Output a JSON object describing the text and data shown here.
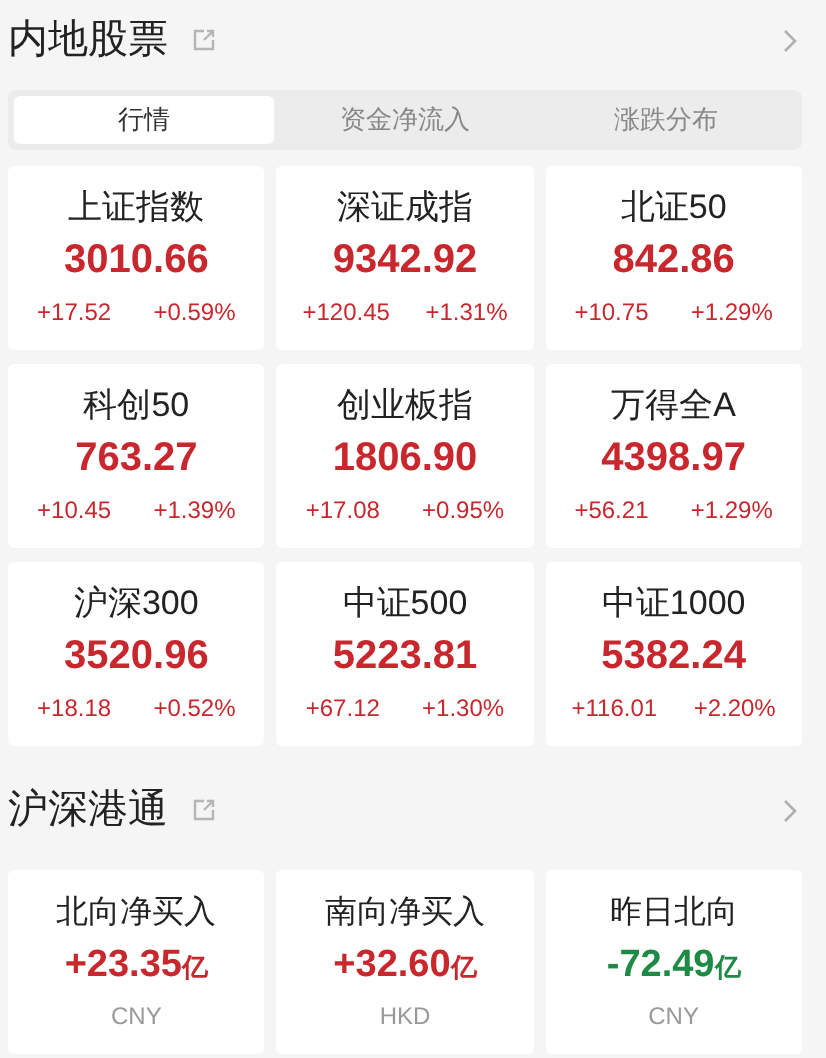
{
  "mainland": {
    "title": "内地股票",
    "tabs": [
      {
        "label": "行情",
        "selected": true
      },
      {
        "label": "资金净流入",
        "selected": false
      },
      {
        "label": "涨跌分布",
        "selected": false
      }
    ],
    "indices": [
      {
        "name": "上证指数",
        "value": "3010.66",
        "change": "+17.52",
        "percent": "+0.59%",
        "color": "#c8272d"
      },
      {
        "name": "深证成指",
        "value": "9342.92",
        "change": "+120.45",
        "percent": "+1.31%",
        "color": "#c8272d"
      },
      {
        "name": "北证50",
        "value": "842.86",
        "change": "+10.75",
        "percent": "+1.29%",
        "color": "#c8272d"
      },
      {
        "name": "科创50",
        "value": "763.27",
        "change": "+10.45",
        "percent": "+1.39%",
        "color": "#c8272d"
      },
      {
        "name": "创业板指",
        "value": "1806.90",
        "change": "+17.08",
        "percent": "+0.95%",
        "color": "#c8272d"
      },
      {
        "name": "万得全A",
        "value": "4398.97",
        "change": "+56.21",
        "percent": "+1.29%",
        "color": "#c8272d"
      },
      {
        "name": "沪深300",
        "value": "3520.96",
        "change": "+18.18",
        "percent": "+0.52%",
        "color": "#c8272d"
      },
      {
        "name": "中证500",
        "value": "5223.81",
        "change": "+67.12",
        "percent": "+1.30%",
        "color": "#c8272d"
      },
      {
        "name": "中证1000",
        "value": "5382.24",
        "change": "+116.01",
        "percent": "+2.20%",
        "color": "#c8272d"
      }
    ]
  },
  "connect": {
    "title": "沪深港通",
    "flows": [
      {
        "name": "北向净买入",
        "value": "+23.35",
        "unit": "亿",
        "currency": "CNY",
        "color": "#c8272d"
      },
      {
        "name": "南向净买入",
        "value": "+32.60",
        "unit": "亿",
        "currency": "HKD",
        "color": "#c8272d"
      },
      {
        "name": "昨日北向",
        "value": "-72.49",
        "unit": "亿",
        "currency": "CNY",
        "color": "#1d8a45"
      }
    ]
  }
}
